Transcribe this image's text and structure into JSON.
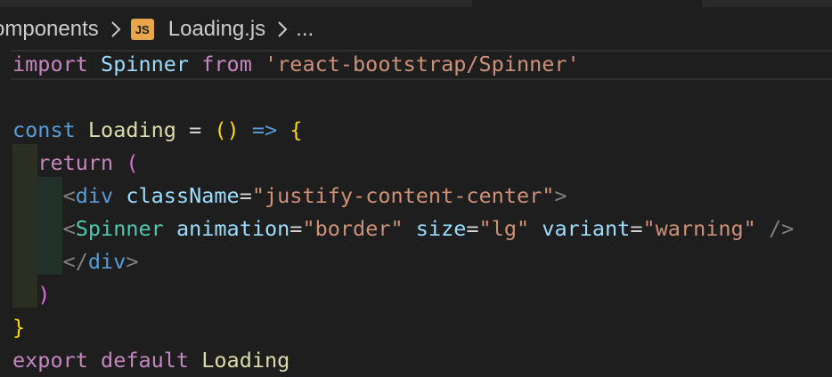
{
  "breadcrumb": {
    "folder": "omponents",
    "file_icon": "JS",
    "file": "Loading.js",
    "more": "..."
  },
  "code_lines": [
    {
      "tokens": [
        {
          "t": "import",
          "c": "kw-pink"
        },
        {
          "t": " ",
          "c": "plain"
        },
        {
          "t": "Spinner",
          "c": "ident"
        },
        {
          "t": " ",
          "c": "plain"
        },
        {
          "t": "from",
          "c": "kw-pink"
        },
        {
          "t": " ",
          "c": "plain"
        },
        {
          "t": "'react-bootstrap/Spinner'",
          "c": "str"
        }
      ]
    },
    {
      "tokens": []
    },
    {
      "tokens": [
        {
          "t": "const",
          "c": "kw-blue"
        },
        {
          "t": " ",
          "c": "plain"
        },
        {
          "t": "Loading",
          "c": "func"
        },
        {
          "t": " = ",
          "c": "plain"
        },
        {
          "t": "()",
          "c": "brace-gold"
        },
        {
          "t": " ",
          "c": "plain"
        },
        {
          "t": "=>",
          "c": "kw-blue"
        },
        {
          "t": " ",
          "c": "plain"
        },
        {
          "t": "{",
          "c": "brace-gold"
        }
      ]
    },
    {
      "tokens": [
        {
          "t": "  ",
          "c": "plain"
        },
        {
          "t": "return",
          "c": "kw-pink"
        },
        {
          "t": " ",
          "c": "plain"
        },
        {
          "t": "(",
          "c": "paren-pink"
        }
      ]
    },
    {
      "tokens": [
        {
          "t": "    ",
          "c": "plain"
        },
        {
          "t": "<",
          "c": "tag-punct"
        },
        {
          "t": "div",
          "c": "tag-name"
        },
        {
          "t": " ",
          "c": "plain"
        },
        {
          "t": "className",
          "c": "attr"
        },
        {
          "t": "=",
          "c": "plain"
        },
        {
          "t": "\"justify-content-center\"",
          "c": "str"
        },
        {
          "t": ">",
          "c": "tag-punct"
        }
      ]
    },
    {
      "tokens": [
        {
          "t": "    ",
          "c": "plain"
        },
        {
          "t": "<",
          "c": "tag-punct"
        },
        {
          "t": "Spinner",
          "c": "comp-name"
        },
        {
          "t": " ",
          "c": "plain"
        },
        {
          "t": "animation",
          "c": "attr"
        },
        {
          "t": "=",
          "c": "plain"
        },
        {
          "t": "\"border\"",
          "c": "str"
        },
        {
          "t": " ",
          "c": "plain"
        },
        {
          "t": "size",
          "c": "attr"
        },
        {
          "t": "=",
          "c": "plain"
        },
        {
          "t": "\"lg\"",
          "c": "str"
        },
        {
          "t": " ",
          "c": "plain"
        },
        {
          "t": "variant",
          "c": "attr"
        },
        {
          "t": "=",
          "c": "plain"
        },
        {
          "t": "\"warning\"",
          "c": "str"
        },
        {
          "t": " ",
          "c": "plain"
        },
        {
          "t": "/>",
          "c": "tag-punct"
        }
      ]
    },
    {
      "tokens": [
        {
          "t": "    ",
          "c": "plain"
        },
        {
          "t": "</",
          "c": "tag-punct"
        },
        {
          "t": "div",
          "c": "tag-name"
        },
        {
          "t": ">",
          "c": "tag-punct"
        }
      ]
    },
    {
      "tokens": [
        {
          "t": "  ",
          "c": "plain"
        },
        {
          "t": ")",
          "c": "paren-pink"
        }
      ]
    },
    {
      "tokens": [
        {
          "t": "}",
          "c": "brace-gold"
        }
      ]
    },
    {
      "tokens": [
        {
          "t": "export",
          "c": "kw-pink"
        },
        {
          "t": " ",
          "c": "plain"
        },
        {
          "t": "default",
          "c": "kw-pink"
        },
        {
          "t": " ",
          "c": "plain"
        },
        {
          "t": "Loading",
          "c": "func"
        }
      ]
    }
  ],
  "colors": {
    "background": "#1e1e1e",
    "keyword_pink": "#c586c0",
    "keyword_blue": "#569cd6",
    "identifier": "#9cdcfe",
    "function": "#dcdcaa",
    "string": "#ce9178",
    "component": "#4ec9b0",
    "bracket_gold": "#ffd700",
    "bracket_pink": "#da70d6",
    "js_icon": "#e8a64a"
  }
}
